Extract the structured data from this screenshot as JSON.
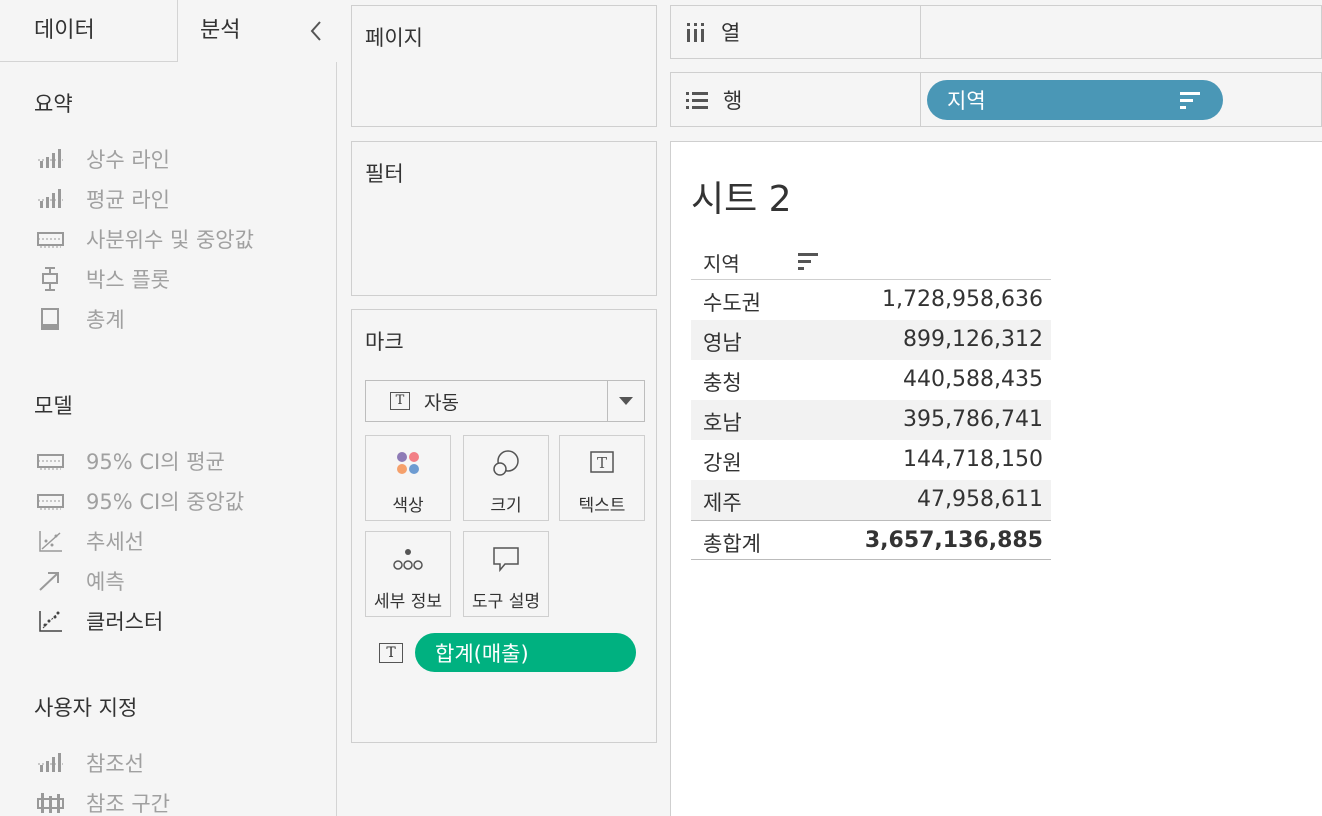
{
  "left_pane": {
    "tabs": {
      "data": "데이터",
      "analysis": "분석"
    },
    "sections": [
      {
        "title": "요약",
        "items": [
          {
            "label": "상수 라인",
            "icon": "bar-line-icon",
            "active": false
          },
          {
            "label": "평균 라인",
            "icon": "bar-line-icon",
            "active": false
          },
          {
            "label": "사분위수 및 중앙값",
            "icon": "quartile-icon",
            "active": false
          },
          {
            "label": "박스 플롯",
            "icon": "box-plot-icon",
            "active": false
          },
          {
            "label": "총계",
            "icon": "totals-icon",
            "active": false
          }
        ]
      },
      {
        "title": "모델",
        "items": [
          {
            "label": "95% CI의 평균",
            "icon": "ci-band-icon",
            "active": false
          },
          {
            "label": "95% CI의 중앙값",
            "icon": "ci-band-icon",
            "active": false
          },
          {
            "label": "추세선",
            "icon": "trend-icon",
            "active": false
          },
          {
            "label": "예측",
            "icon": "forecast-icon",
            "active": false
          },
          {
            "label": "클러스터",
            "icon": "cluster-icon",
            "active": true
          }
        ]
      },
      {
        "title": "사용자 지정",
        "items": [
          {
            "label": "참조선",
            "icon": "bar-line-icon",
            "active": false
          },
          {
            "label": "참조 구간",
            "icon": "ref-band-icon",
            "active": false
          }
        ]
      }
    ]
  },
  "cards": {
    "pages": "페이지",
    "filters": "필터",
    "marks": {
      "title": "마크",
      "type_label": "자동",
      "type_icon_glyph": "T",
      "buttons": [
        "색상",
        "크기",
        "텍스트",
        "세부 정보",
        "도구 설명"
      ],
      "pill_glyph": "T",
      "pill_label": "합계(매출)"
    }
  },
  "shelves": {
    "columns_label": "열",
    "rows_label": "행",
    "rows_pill": "지역"
  },
  "sheet": {
    "title": "시트 2",
    "header": "지역",
    "rows": [
      {
        "region": "수도권",
        "value": "1,728,958,636"
      },
      {
        "region": "영남",
        "value": "899,126,312"
      },
      {
        "region": "충청",
        "value": "440,588,435"
      },
      {
        "region": "호남",
        "value": "395,786,741"
      },
      {
        "region": "강원",
        "value": "144,718,150"
      },
      {
        "region": "제주",
        "value": "47,958,611"
      }
    ],
    "total": {
      "label": "총합계",
      "value": "3,657,136,885"
    }
  },
  "colors": {
    "dimension_pill": "#4a97b6",
    "measure_pill": "#00b180",
    "mark_dots": [
      "#8e7bb6",
      "#f27f86",
      "#f5a06b",
      "#6d9bd1"
    ]
  }
}
